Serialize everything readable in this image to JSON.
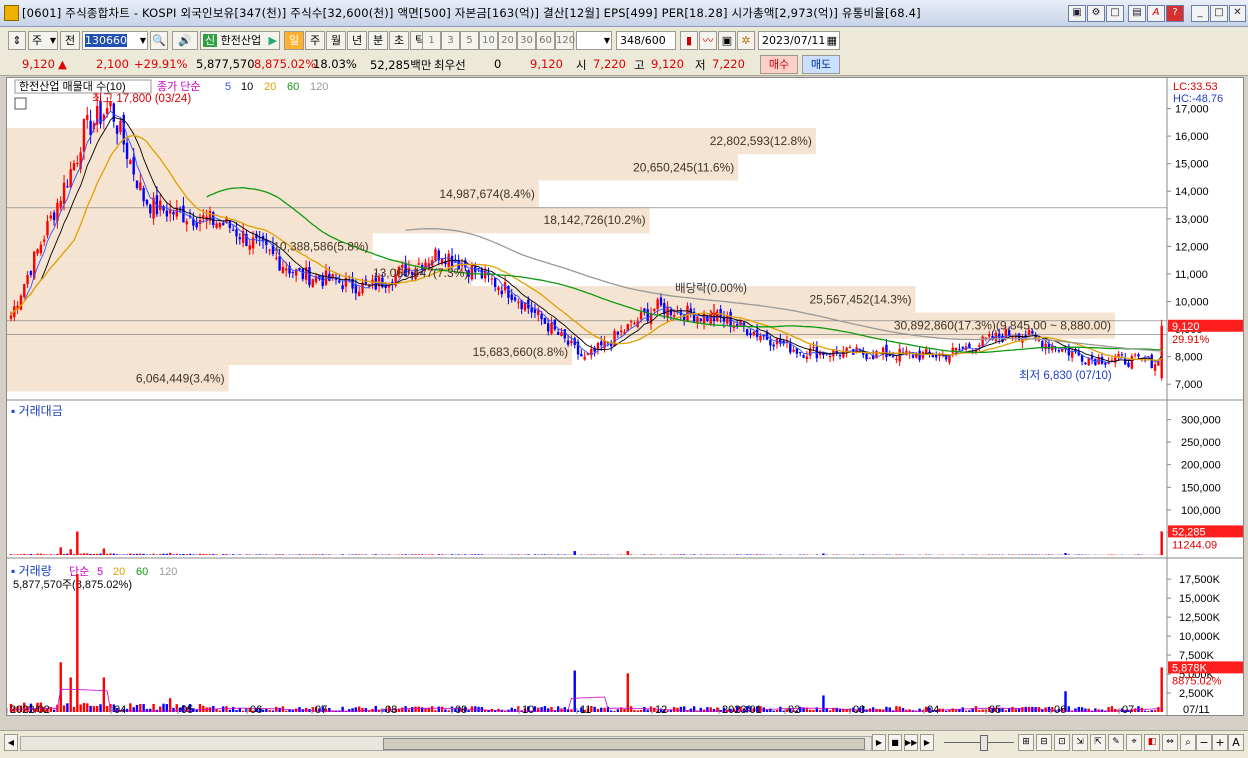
{
  "title": "[0601] 주식종합차트 - KOSPI 외국인보유[347(천)] 주식수[32,600(천)] 액면[500] 자본금[163(억)] 결산[12월] EPS[499] PER[18.28] 시가총액[2,973(억)] 유통비율[68.4]",
  "toolbar": {
    "period_select": "주",
    "prev_label": "전",
    "code": "130660",
    "stock_name": "한전산업",
    "sin_badge": "신",
    "periods": [
      "일",
      "주",
      "월",
      "년",
      "분",
      "초",
      "틱"
    ],
    "active_period": "일",
    "intervals": [
      "1",
      "3",
      "5",
      "10",
      "20",
      "30",
      "60",
      "120"
    ],
    "count": "348",
    "count_total": "/600",
    "date": "2023/07/11"
  },
  "quote": {
    "price": "9,120",
    "change": "2,100",
    "change_pct": "+29.91%",
    "volume": "5,877,570",
    "volume_ratio": "8,875.02%",
    "turnover": "18.03%",
    "amount": "52,285백만",
    "priority_label": "최우선",
    "priority_value": "0",
    "priority_price": "9,120",
    "open_label": "시",
    "open": "7,220",
    "high_label": "고",
    "high": "9,120",
    "low_label": "저",
    "low": "7,220",
    "buy_label": "매수",
    "sell_label": "매도"
  },
  "price_panel": {
    "tab_label": "한전산업 매물대 수(10)",
    "legend_prefix": "종가 단순",
    "ma_periods": [
      {
        "label": "5",
        "color": "#3050ff"
      },
      {
        "label": "10",
        "color": "#000000"
      },
      {
        "label": "20",
        "color": "#e0a000"
      },
      {
        "label": "60",
        "color": "#119911"
      },
      {
        "label": "120",
        "color": "#999999"
      }
    ],
    "high_marker": "최고 17,800 (03/24)",
    "low_marker": "최저 6,830 (07/10)",
    "lc_label": "LC:33.53",
    "hc_label": "HC:-48.76",
    "dividend_label": "배당락(0.00%)",
    "last_price_tag": "9,120",
    "last_change_tag": "29.91%",
    "yticks": [
      "17,000",
      "16,000",
      "15,000",
      "14,000",
      "13,000",
      "12,000",
      "11,000",
      "10,000",
      "9,000",
      "8,000",
      "7,000"
    ],
    "volume_profile": [
      {
        "text": "22,802,593(12.8%)",
        "w": 0.73
      },
      {
        "text": "20,650,245(11.6%)",
        "w": 0.66
      },
      {
        "text": "14,987,674(8.4%)",
        "w": 0.48
      },
      {
        "text": "18,142,726(10.2%)",
        "w": 0.58
      },
      {
        "text": "10,388,586(5.8%)",
        "w": 0.33
      },
      {
        "text": "13,060,447(7.3%)",
        "w": 0.42
      },
      {
        "text": "25,567,452(14.3%)",
        "w": 0.82
      },
      {
        "text": "30,892,860(17.3%)(9,845.00 ~ 8,880.00)",
        "w": 1.0
      },
      {
        "text": "15,683,660(8.8%)",
        "w": 0.51
      },
      {
        "text": "6,064,449(3.4%)",
        "w": 0.2
      }
    ]
  },
  "amount_panel": {
    "label": "거래대금",
    "yticks": [
      "300,000",
      "250,000",
      "200,000",
      "150,000",
      "100,000",
      "50,000"
    ],
    "last_tag": "52,285",
    "avg_tag": "11244.09"
  },
  "volume_panel": {
    "label": "거래량",
    "legend_prefix": "단순",
    "ma_periods": [
      {
        "label": "5",
        "color": "#cc00cc"
      },
      {
        "label": "20",
        "color": "#e0a000"
      },
      {
        "label": "60",
        "color": "#119911"
      },
      {
        "label": "120",
        "color": "#999999"
      }
    ],
    "info": "5,877,570주(8,875.02%)",
    "yticks": [
      "17,500K",
      "15,000K",
      "12,500K",
      "10,000K",
      "7,500K",
      "5,000K",
      "2,500K"
    ],
    "last_tag": "5,878K",
    "pct_tag": "8875.02%"
  },
  "xaxis": {
    "labels": [
      "2022/02",
      "04",
      "05",
      "06",
      "07",
      "08",
      "09",
      "10",
      "11",
      "12",
      "2023/01",
      "02",
      "03",
      "04",
      "05",
      "06",
      "07"
    ],
    "right_label": "07/11"
  },
  "colors": {
    "up": "#ff0000",
    "down": "#0000ff",
    "profile": "#f5e4d2",
    "tag_bg": "#ff1e1e"
  },
  "chart_data": {
    "type": "candlestick",
    "x": [
      "2022/02",
      "2022/03",
      "2022/04",
      "2022/05",
      "2022/06",
      "2022/07",
      "2022/08",
      "2022/09",
      "2022/10",
      "2022/11",
      "2022/12",
      "2023/01",
      "2023/02",
      "2023/03",
      "2023/04",
      "2023/05",
      "2023/06",
      "2023/07"
    ],
    "close": [
      9500,
      15800,
      13400,
      12800,
      11000,
      10500,
      11800,
      10300,
      7900,
      9800,
      9300,
      8200,
      8100,
      8050,
      8900,
      7950,
      7800,
      9120
    ],
    "ylim": [
      6500,
      17600
    ],
    "last": {
      "open": 7220,
      "high": 9120,
      "low": 7220,
      "close": 9120
    }
  }
}
